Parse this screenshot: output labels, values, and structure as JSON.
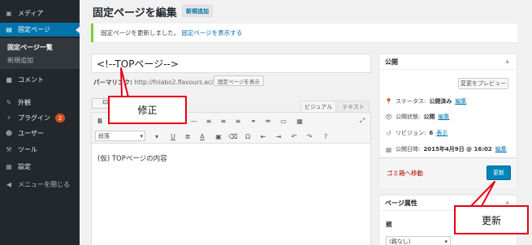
{
  "sidebar": {
    "items": [
      {
        "label": "メディア",
        "icon": "media-icon"
      },
      {
        "label": "固定ページ",
        "icon": "pages-icon",
        "active": true
      },
      {
        "label": "コメント",
        "icon": "comments-icon"
      },
      {
        "label": "外観",
        "icon": "appearance-icon"
      },
      {
        "label": "プラグイン",
        "icon": "plugins-icon",
        "badge": "2"
      },
      {
        "label": "ユーザー",
        "icon": "users-icon"
      },
      {
        "label": "ツール",
        "icon": "tools-icon"
      },
      {
        "label": "設定",
        "icon": "settings-icon"
      },
      {
        "label": "メニューを閉じる",
        "icon": "collapse-icon"
      }
    ],
    "submenu": [
      "固定ページ一覧",
      "新規追加"
    ]
  },
  "header": {
    "title": "固定ページを編集",
    "add_new": "新規追加"
  },
  "notice": {
    "text": "固定ページを更新しました。",
    "link": "固定ページを表示する"
  },
  "editor": {
    "title_value": "<!--TOPページ-->",
    "permalink_label": "パーマリンク:",
    "permalink_url": "http://fnlabo2.flavours.ac/",
    "permalink_button": "固定ページを表示",
    "tab_visual": "ビジュアル",
    "tab_text": "テキスト",
    "format_select": "段落",
    "content": "(仮) TOPページの内容"
  },
  "publish_box": {
    "title": "公開",
    "preview_button": "変更をプレビュー",
    "status_label": "ステータス:",
    "status_value": "公開済み",
    "visibility_label": "公開状態:",
    "visibility_value": "公開",
    "revisions_label": "リビジョン:",
    "revisions_value": "6",
    "revisions_link": "表示",
    "date_label": "公開日時:",
    "date_value": "2015年4月9日 @ 16:02",
    "edit_link": "編集",
    "trash_link": "ゴミ箱へ移動",
    "update_button": "更新"
  },
  "attributes_box": {
    "title": "ページ属性",
    "parent_label": "親",
    "parent_value": "(親なし)"
  },
  "annotations": {
    "callout_title": "修正",
    "callout_update": "更新"
  },
  "colors": {
    "accent": "#0073aa",
    "sidebar": "#23282d",
    "callout_border": "#e60012",
    "notice_border": "#7ad03a"
  }
}
